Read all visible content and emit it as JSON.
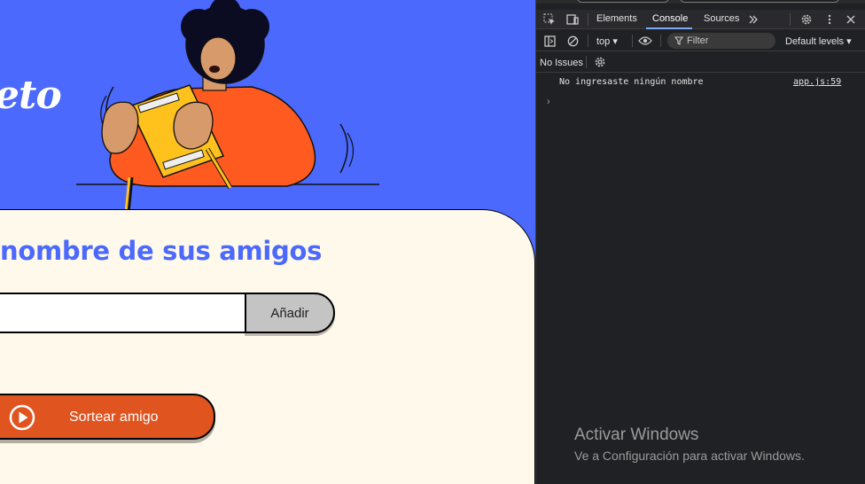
{
  "page": {
    "hero_title": "eto",
    "card_title": "nombre de sus amigos",
    "name_input": {
      "value": "",
      "placeholder": ""
    },
    "add_button_label": "Añadir",
    "draw_button_label": "Sortear amigo",
    "colors": {
      "hero_bg": "#4b69fd",
      "card_bg": "#fff9eb",
      "title": "#4b69fd",
      "draw_button": "#e0541f",
      "add_button": "#c4c4c4"
    }
  },
  "devtools": {
    "tabs": [
      {
        "label": "Elements",
        "active": false
      },
      {
        "label": "Console",
        "active": true
      },
      {
        "label": "Sources",
        "active": false
      }
    ],
    "toolbar": {
      "context": "top",
      "filter_placeholder": "Filter",
      "levels": "Default levels"
    },
    "issues_label": "No Issues",
    "console_messages": [
      {
        "text": "No ingresaste ningún nombre",
        "source": "app.js:59"
      }
    ],
    "icons": [
      "inspect-icon",
      "device-toggle-icon",
      "more-tabs-icon",
      "settings-icon",
      "kebab-menu-icon",
      "close-icon",
      "sidebar-icon",
      "clear-console-icon",
      "eye-icon",
      "filter-icon",
      "chevron-right-icon"
    ]
  },
  "watermark": {
    "title": "Activar Windows",
    "subtitle": "Ve a Configuración para activar Windows."
  }
}
